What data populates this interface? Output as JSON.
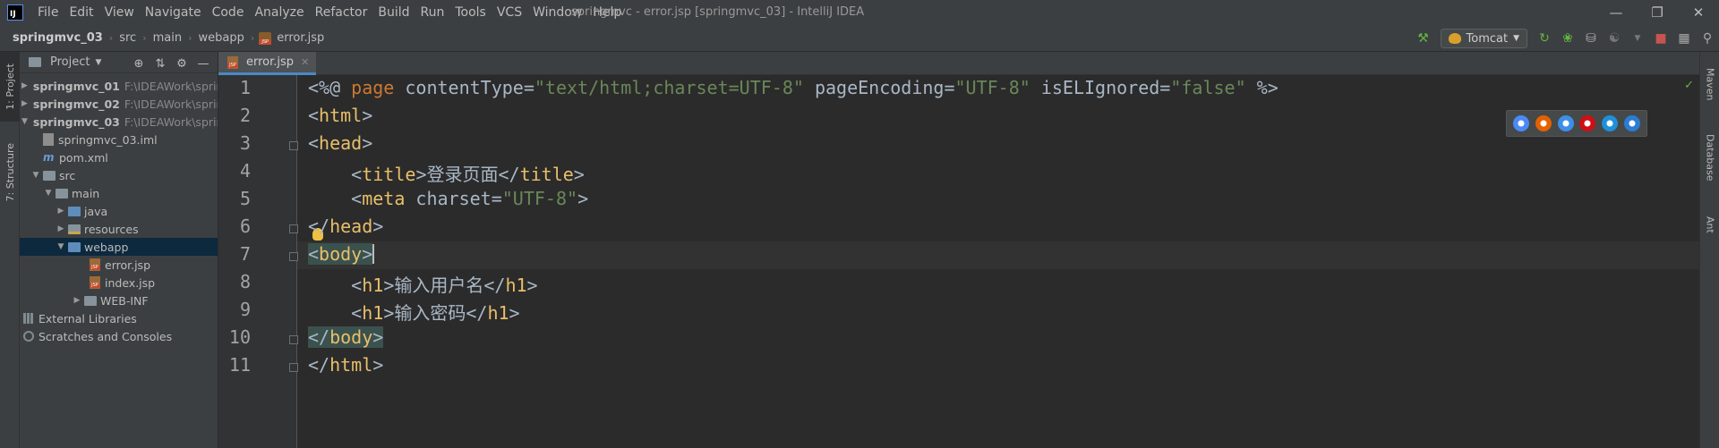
{
  "app": {
    "logo_text": "IJ",
    "window_title": "springmvc - error.jsp [springmvc_03] - IntelliJ IDEA"
  },
  "menu": [
    "File",
    "Edit",
    "View",
    "Navigate",
    "Code",
    "Analyze",
    "Refactor",
    "Build",
    "Run",
    "Tools",
    "VCS",
    "Window",
    "Help"
  ],
  "breadcrumb": [
    "springmvc_03",
    "src",
    "main",
    "webapp",
    "error.jsp"
  ],
  "run_config": {
    "label": "Tomcat"
  },
  "left_tabs": [
    "1: Project",
    "7: Structure"
  ],
  "right_tabs": [
    "Maven",
    "Database",
    "Ant"
  ],
  "project_panel": {
    "title": "Project",
    "tree": [
      {
        "label": "springmvc_01",
        "hint": "F:\\IDEAWork\\sprir",
        "icon": "module-folder-icon",
        "bold": true
      },
      {
        "label": "springmvc_02",
        "hint": "F:\\IDEAWork\\sprir",
        "icon": "module-folder-icon",
        "bold": true
      },
      {
        "label": "springmvc_03",
        "hint": "F:\\IDEAWork\\sprir",
        "icon": "module-folder-icon",
        "bold": true
      },
      {
        "label": "springmvc_03.iml",
        "icon": "iml-file-icon"
      },
      {
        "label": "pom.xml",
        "icon": "maven-icon"
      },
      {
        "label": "src",
        "icon": "folder-icon"
      },
      {
        "label": "main",
        "icon": "folder-icon"
      },
      {
        "label": "java",
        "icon": "source-folder-icon"
      },
      {
        "label": "resources",
        "icon": "resources-folder-icon"
      },
      {
        "label": "webapp",
        "icon": "web-folder-icon",
        "selected": true
      },
      {
        "label": "error.jsp",
        "icon": "jsp-file-icon"
      },
      {
        "label": "index.jsp",
        "icon": "jsp-file-icon"
      },
      {
        "label": "WEB-INF",
        "icon": "folder-icon"
      },
      {
        "label": "External Libraries",
        "icon": "library-icon"
      },
      {
        "label": "Scratches and Consoles",
        "icon": "scratches-icon"
      }
    ]
  },
  "editor": {
    "tab_label": "error.jsp",
    "line_numbers": [
      "1",
      "2",
      "3",
      "4",
      "5",
      "6",
      "7",
      "8",
      "9",
      "10",
      "11"
    ],
    "lines": {
      "l1": {
        "open": "<%@ ",
        "dir": "page",
        "a1": " contentType=",
        "v1": "\"text/html;charset=UTF-8\"",
        "a2": " pageEncoding=",
        "v2": "\"UTF-8\"",
        "a3": " isELIgnored=",
        "v3": "\"false\"",
        "close": " %>"
      },
      "l2": {
        "lt": "<",
        "name": "html",
        "gt": ">"
      },
      "l3": {
        "lt": "<",
        "name": "head",
        "gt": ">"
      },
      "l4": {
        "indent": "    ",
        "lt": "<",
        "name": "title",
        "gt": ">",
        "text": "登录页面",
        "clt": "</",
        "cname": "title",
        "cgt": ">"
      },
      "l5": {
        "indent": "    ",
        "lt": "<",
        "name": "meta",
        "attr": " charset=",
        "val": "\"UTF-8\"",
        "gt": ">"
      },
      "l6": {
        "lt": "</",
        "name": "head",
        "gt": ">"
      },
      "l7": {
        "lt": "<",
        "name": "body",
        "gt": ">"
      },
      "l8": {
        "indent": "    ",
        "lt": "<",
        "name": "h1",
        "gt": ">",
        "text": "输入用户名",
        "clt": "</",
        "cname": "h1",
        "cgt": ">"
      },
      "l9": {
        "indent": "    ",
        "lt": "<",
        "name": "h1",
        "gt": ">",
        "text": "输入密码",
        "clt": "</",
        "cname": "h1",
        "cgt": ">"
      },
      "l10": {
        "lt": "</",
        "name": "body",
        "gt": ">"
      },
      "l11": {
        "lt": "</",
        "name": "html",
        "gt": ">"
      }
    }
  },
  "browser_popup": [
    {
      "name": "chrome-icon",
      "color": "#4a8af4"
    },
    {
      "name": "firefox-icon",
      "color": "#e66000"
    },
    {
      "name": "safari-icon",
      "color": "#3d8ee6"
    },
    {
      "name": "opera-icon",
      "color": "#cc0f16"
    },
    {
      "name": "ie-icon",
      "color": "#1e90d8"
    },
    {
      "name": "edge-icon",
      "color": "#2b7cd3"
    }
  ],
  "colors": {
    "tag": "#e8bf6a",
    "string": "#6a8759",
    "keyword": "#cc7832",
    "text": "#a9b7c6",
    "selection": "#0d293e",
    "tab_underline": "#4a88c7"
  }
}
